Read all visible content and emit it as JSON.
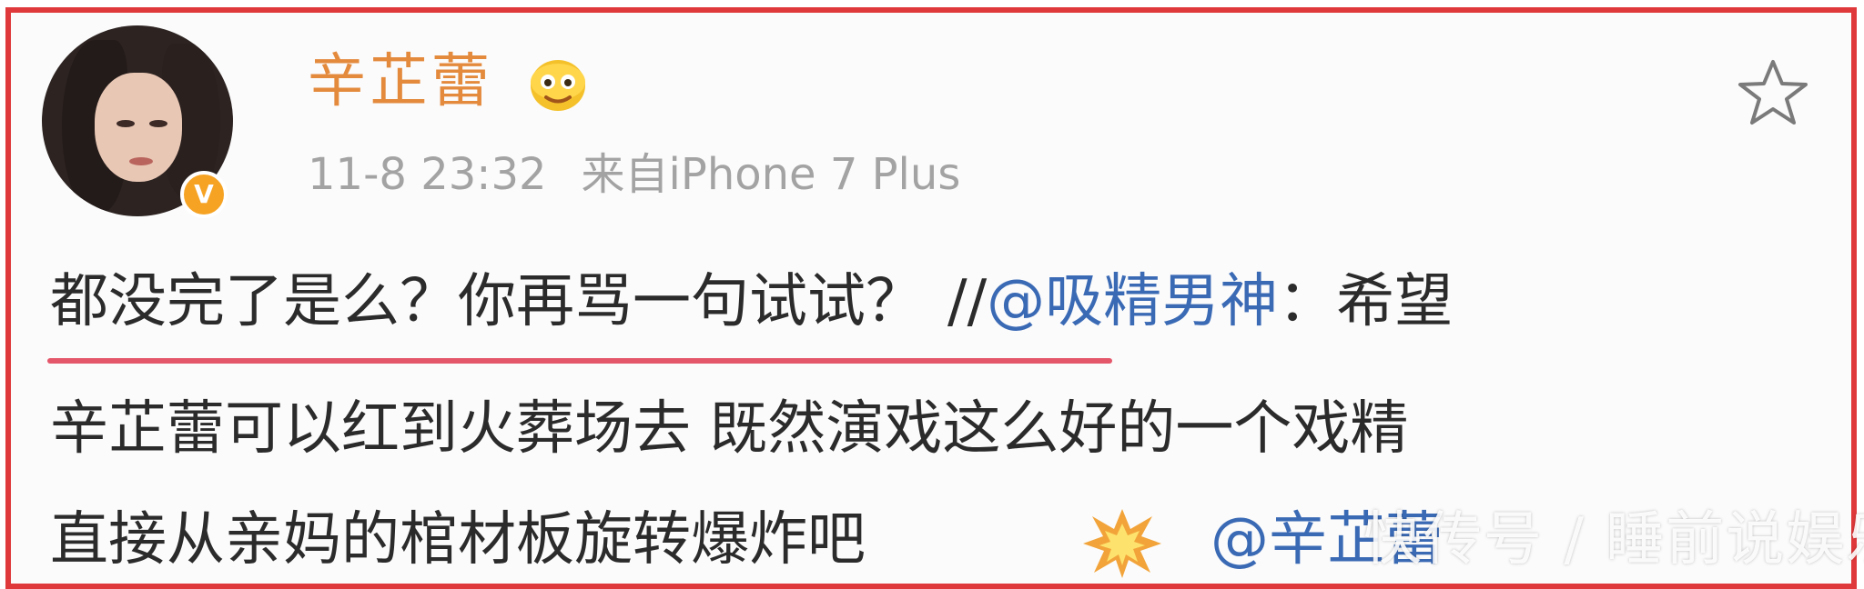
{
  "post": {
    "username": "辛芷蕾",
    "timestamp": "11-8 23:32",
    "source": "来自iPhone 7 Plus",
    "line1_main": "都没完了是么？你再骂一句试试？",
    "line1_repost_prefix": "//",
    "line1_mention": "@吸精男神",
    "line1_tail": "：希望",
    "line2": "辛芷蕾可以红到火葬场去 既然演戏这么好的一个戏精",
    "line3_main": "直接从亲妈的棺材板旋转爆炸吧",
    "line3_mention": "@辛芷蕾"
  },
  "watermark": "快传号 / 睡前说娱乐",
  "icons": {
    "avatar": "avatar-photo",
    "verified": "verified-v-icon",
    "vip": "vip-emoji-icon",
    "favorite": "star-icon",
    "explosion": "explosion-emoji-icon"
  },
  "colors": {
    "border": "#e0393b",
    "username": "#e38a3d",
    "meta": "#a3a3a3",
    "mention": "#3b6ab5",
    "underline": "#e4576a",
    "verified": "#f6a323"
  }
}
